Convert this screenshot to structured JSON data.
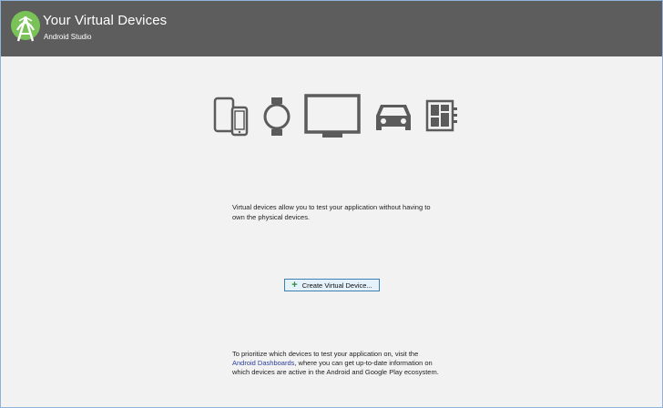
{
  "header": {
    "title": "Your Virtual Devices",
    "subtitle": "Android Studio"
  },
  "device_icons": [
    "phone-tablet-icon",
    "watch-icon",
    "tv-icon",
    "car-icon",
    "things-icon"
  ],
  "description": "Virtual devices allow you to test your application without having to own the physical devices.",
  "create_button": {
    "icon": "plus-icon",
    "label": "Create Virtual Device..."
  },
  "footer": {
    "before": "To prioritize which devices to test your application on, visit the",
    "link": "Android Dashboards",
    "after": ", where you can get up-to-date information on which devices are active in the Android and Google Play ecosystem."
  },
  "colors": {
    "header_bg": "#5d5d5d",
    "body_bg": "#f2f2f2",
    "icon": "#5b5b5b",
    "android_green": "#79c257",
    "link": "#2a3f9d",
    "button_border": "#3c7fb1",
    "button_bg": "#e5f1fb"
  }
}
